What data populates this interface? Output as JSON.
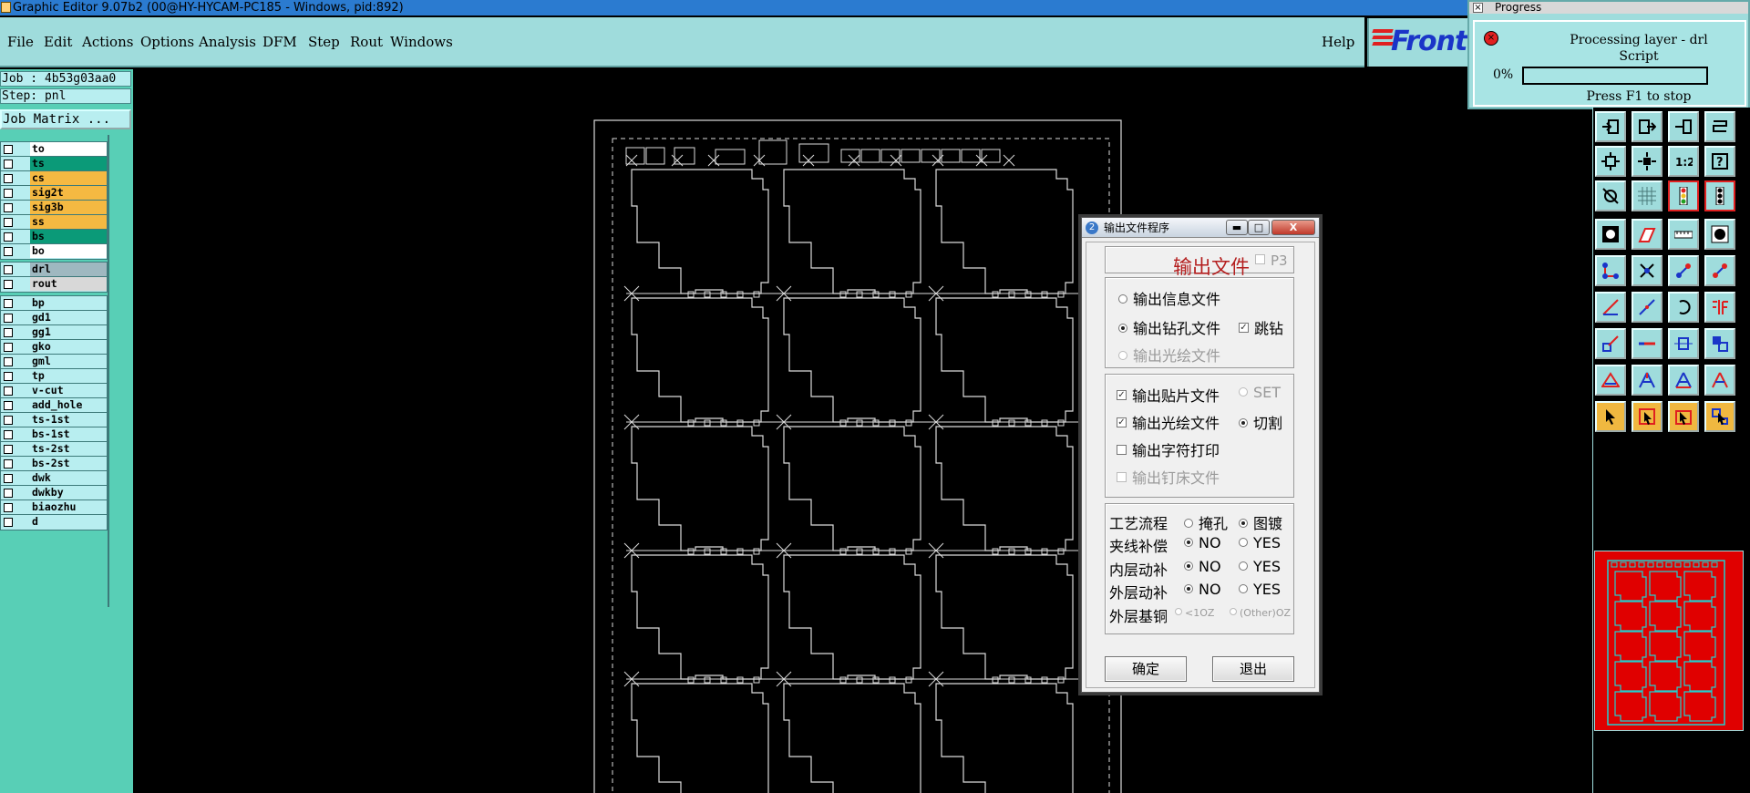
{
  "window": {
    "title": "Graphic Editor 9.07b2 (00@HY-HYCAM-PC185 - Windows, pid:892)"
  },
  "menu": {
    "items": [
      "File",
      "Edit",
      "Actions",
      "Options",
      "Analysis",
      "DFM",
      "Step",
      "Rout",
      "Windows"
    ],
    "help": "Help",
    "logo": "Front"
  },
  "left_panel": {
    "job": "Job : 4b53g03aa0",
    "step": "Step: pnl",
    "job_matrix": "Job Matrix ...",
    "layer_groups": [
      [
        {
          "name": "to",
          "color": "#ffffff"
        },
        {
          "name": "ts",
          "color": "#0b9a78"
        },
        {
          "name": "cs",
          "color": "#f5b942"
        },
        {
          "name": "sig2t",
          "color": "#f5b942"
        },
        {
          "name": "sig3b",
          "color": "#f5b942"
        },
        {
          "name": "ss",
          "color": "#f5b942"
        },
        {
          "name": "bs",
          "color": "#0b9a78"
        },
        {
          "name": "bo",
          "color": "#ffffff"
        }
      ],
      [
        {
          "name": "drl",
          "color": "#9fb8c0"
        },
        {
          "name": "rout",
          "color": "#d8d8d8"
        }
      ],
      [
        {
          "name": "bp",
          "color": "#b8eef0"
        },
        {
          "name": "gd1",
          "color": "#b8eef0"
        },
        {
          "name": "gg1",
          "color": "#b8eef0"
        },
        {
          "name": "gko",
          "color": "#b8eef0"
        },
        {
          "name": "gml",
          "color": "#b8eef0"
        },
        {
          "name": "tp",
          "color": "#b8eef0"
        },
        {
          "name": "v-cut",
          "color": "#b8eef0"
        },
        {
          "name": "add_hole",
          "color": "#b8eef0"
        },
        {
          "name": "ts-1st",
          "color": "#b8eef0"
        },
        {
          "name": "bs-1st",
          "color": "#b8eef0"
        },
        {
          "name": "ts-2st",
          "color": "#b8eef0"
        },
        {
          "name": "bs-2st",
          "color": "#b8eef0"
        },
        {
          "name": "dwk",
          "color": "#b8eef0"
        },
        {
          "name": "dwkby",
          "color": "#b8eef0"
        },
        {
          "name": "biaozhu",
          "color": "#b8eef0"
        },
        {
          "name": "d",
          "color": "#b8eef0"
        }
      ]
    ]
  },
  "progress": {
    "title": "Progress",
    "line1": "Processing layer - drl",
    "line2": "Script",
    "percent_label": "0%",
    "percent_value": 0,
    "hint": "Press F1 to stop"
  },
  "dialog": {
    "title": "输出文件程序",
    "title_min": "▬",
    "title_max": "□",
    "title_close": "X",
    "heading": "输出文件",
    "p3_label": "P3",
    "opt_info": "输出信息文件",
    "opt_drill": "输出钻孔文件",
    "opt_jump": "跳钻",
    "opt_gerber1": "输出光绘文件",
    "opt_smt": "输出贴片文件",
    "opt_set": "SET",
    "opt_gerber2": "输出光绘文件",
    "opt_cut": "切割",
    "opt_char": "输出字符打印",
    "opt_bed": "输出钉床文件",
    "process_label": "工艺流程",
    "process_a": "掩孔",
    "process_b": "图镀",
    "clip_label": "夹线补偿",
    "inner_label": "内层动补",
    "outer_label": "外层动补",
    "no": "NO",
    "yes": "YES",
    "base_cu_label": "外层基铜",
    "base_cu_a": "<1OZ",
    "base_cu_b": "(Other)OZ",
    "ok": "确定",
    "exit": "退出"
  }
}
